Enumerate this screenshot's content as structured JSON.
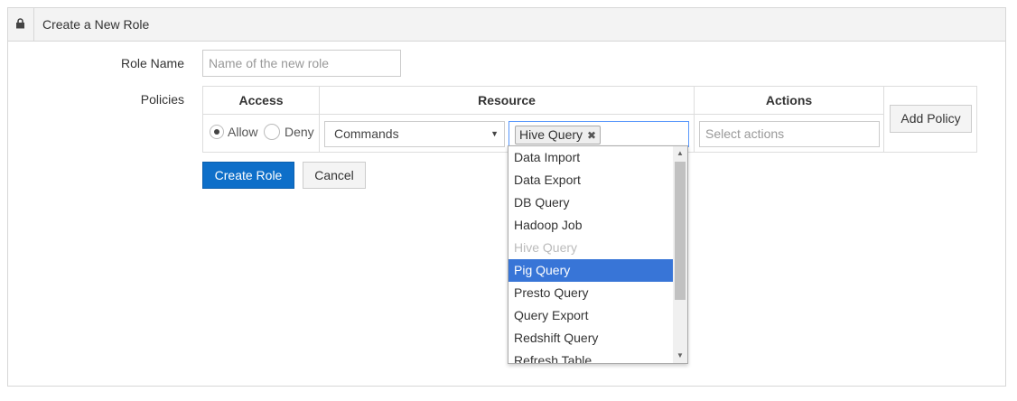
{
  "panel": {
    "title": "Create a New Role",
    "icon": "lock-icon"
  },
  "form": {
    "role_name_label": "Role Name",
    "role_name_placeholder": "Name of the new role",
    "role_name_value": "",
    "policies_label": "Policies"
  },
  "policies_table": {
    "headers": [
      "Access",
      "Resource",
      "Actions"
    ],
    "access": {
      "options": [
        "Allow",
        "Deny"
      ],
      "selected": "Allow"
    },
    "resource_type": {
      "selected": "Commands"
    },
    "resource_tags": [
      "Hive Query"
    ],
    "actions_placeholder": "Select actions",
    "add_policy_label": "Add Policy"
  },
  "buttons": {
    "create_role": "Create Role",
    "cancel": "Cancel"
  },
  "dropdown": {
    "items": [
      {
        "label": "Data Import",
        "state": "normal"
      },
      {
        "label": "Data Export",
        "state": "normal"
      },
      {
        "label": "DB Query",
        "state": "normal"
      },
      {
        "label": "Hadoop Job",
        "state": "normal"
      },
      {
        "label": "Hive Query",
        "state": "disabled"
      },
      {
        "label": "Pig Query",
        "state": "highlighted"
      },
      {
        "label": "Presto Query",
        "state": "normal"
      },
      {
        "label": "Query Export",
        "state": "normal"
      },
      {
        "label": "Redshift Query",
        "state": "normal"
      },
      {
        "label": "Refresh Table",
        "state": "normal"
      }
    ]
  },
  "colors": {
    "primary": "#0e6fc9",
    "highlight": "#3875d7"
  }
}
